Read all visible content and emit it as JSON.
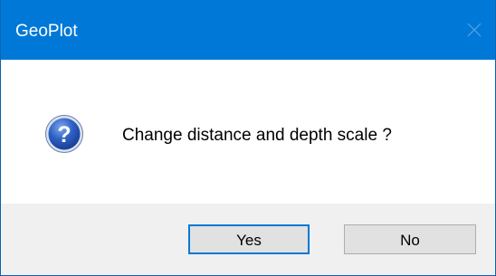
{
  "window": {
    "title": "GeoPlot"
  },
  "dialog": {
    "message": "Change distance and depth scale ?",
    "icon": "question-icon"
  },
  "buttons": {
    "yes_label": "Yes",
    "no_label": "No"
  },
  "colors": {
    "titlebar": "#0078d7",
    "footer": "#f0f0f0",
    "button_face": "#e1e1e1",
    "default_button_border": "#0078d7"
  }
}
